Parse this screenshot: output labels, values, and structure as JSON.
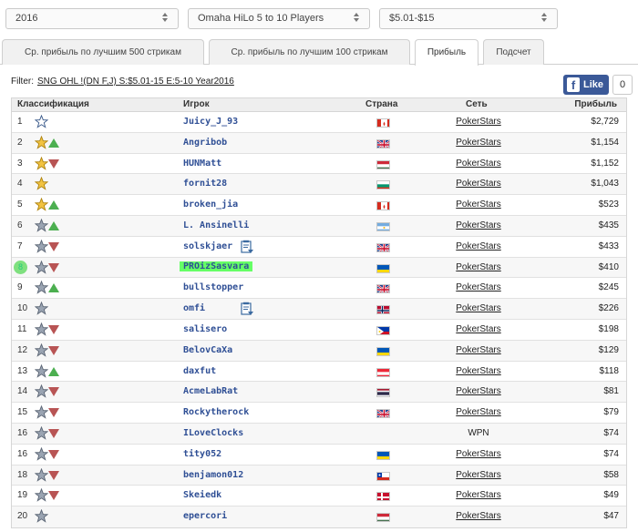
{
  "filters": {
    "year": "2016",
    "game": "Omaha HiLo 5 to 10 Players",
    "stakes": "$5.01-$15"
  },
  "tabs": [
    {
      "label": "Ср. прибыль по лучшим 500 стрикам",
      "active": false
    },
    {
      "label": "Ср. прибыль по лучшим 100 стрикам",
      "active": false
    },
    {
      "label": "Прибыль",
      "active": true
    },
    {
      "label": "Подсчет",
      "active": false
    }
  ],
  "filter_line": {
    "label": "Filter:",
    "value": "SNG OHL !(DN F,J) S:$5.01-15 E:5-10 Year2016"
  },
  "facebook": {
    "like_label": "Like",
    "count": "0"
  },
  "table": {
    "headers": {
      "rank": "Классификация",
      "player": "Игрок",
      "country": "Страна",
      "network": "Сеть",
      "profit": "Прибыль"
    },
    "rows": [
      {
        "rank": "1",
        "star": "blue",
        "trend": "none",
        "player": "Juicy_J_93",
        "flag": "canada",
        "network": "PokerStars",
        "profit": "$2,729"
      },
      {
        "rank": "2",
        "star": "gold",
        "trend": "up",
        "player": "Angribob",
        "flag": "uk",
        "network": "PokerStars",
        "profit": "$1,154"
      },
      {
        "rank": "3",
        "star": "gold",
        "trend": "down",
        "player": "HUNMatt",
        "flag": "hungary",
        "network": "PokerStars",
        "profit": "$1,152"
      },
      {
        "rank": "4",
        "star": "gold",
        "trend": "none",
        "player": "fornit28",
        "flag": "bulgaria",
        "network": "PokerStars",
        "profit": "$1,043"
      },
      {
        "rank": "5",
        "star": "gold",
        "trend": "up",
        "player": "broken_jia",
        "flag": "canada",
        "network": "PokerStars",
        "profit": "$523"
      },
      {
        "rank": "6",
        "star": "gray",
        "trend": "up",
        "player": "L. Ansinelli",
        "flag": "argentina",
        "network": "PokerStars",
        "profit": "$435"
      },
      {
        "rank": "7",
        "star": "gray",
        "trend": "down",
        "player": "solskjaer",
        "flag": "uk",
        "network": "PokerStars",
        "profit": "$433",
        "note": true
      },
      {
        "rank": "8",
        "star": "gray",
        "trend": "down",
        "player": "PROizSasvara",
        "flag": "ukraine",
        "network": "PokerStars",
        "profit": "$410",
        "highlight": true
      },
      {
        "rank": "9",
        "star": "gray",
        "trend": "up",
        "player": "bullstopper",
        "flag": "uk",
        "network": "PokerStars",
        "profit": "$245"
      },
      {
        "rank": "10",
        "star": "gray",
        "trend": "none",
        "player": "omfi",
        "flag": "norway",
        "network": "PokerStars",
        "profit": "$226",
        "note": true
      },
      {
        "rank": "11",
        "star": "gray",
        "trend": "down",
        "player": "salisero",
        "flag": "philippines",
        "network": "PokerStars",
        "profit": "$198"
      },
      {
        "rank": "12",
        "star": "gray",
        "trend": "down",
        "player": "BelovCaXa",
        "flag": "ukraine",
        "network": "PokerStars",
        "profit": "$129"
      },
      {
        "rank": "13",
        "star": "gray",
        "trend": "up",
        "player": "daxfut",
        "flag": "austria",
        "network": "PokerStars",
        "profit": "$118"
      },
      {
        "rank": "14",
        "star": "gray",
        "trend": "down",
        "player": "AcmeLabRat",
        "flag": "thailand",
        "network": "PokerStars",
        "profit": "$81"
      },
      {
        "rank": "15",
        "star": "gray",
        "trend": "down",
        "player": "Rockytherock",
        "flag": "uk",
        "network": "PokerStars",
        "profit": "$79"
      },
      {
        "rank": "16",
        "star": "gray",
        "trend": "down",
        "player": "ILoveClocks",
        "flag": "none",
        "network": "WPN",
        "profit": "$74"
      },
      {
        "rank": "16",
        "star": "gray",
        "trend": "down",
        "player": "tity052",
        "flag": "ukraine",
        "network": "PokerStars",
        "profit": "$74"
      },
      {
        "rank": "18",
        "star": "gray",
        "trend": "down",
        "player": "benjamon012",
        "flag": "chile",
        "network": "PokerStars",
        "profit": "$58"
      },
      {
        "rank": "19",
        "star": "gray",
        "trend": "down",
        "player": "Skeiedk",
        "flag": "denmark",
        "network": "PokerStars",
        "profit": "$49"
      },
      {
        "rank": "20",
        "star": "gray",
        "trend": "none",
        "player": "epercori",
        "flag": "hungary",
        "network": "PokerStars",
        "profit": "$47"
      }
    ]
  },
  "colors": {
    "link_blue": "#2f4f95",
    "trend_up": "#4caf50",
    "trend_down": "#b85454",
    "highlight_green": "#66ff66",
    "facebook_blue": "#3b5998"
  }
}
